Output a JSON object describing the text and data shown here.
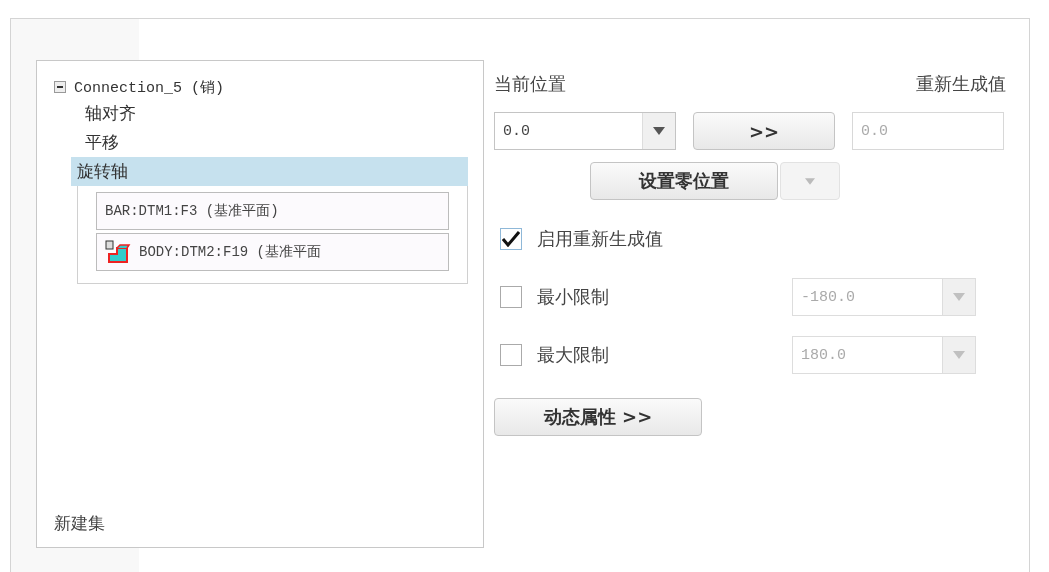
{
  "tree": {
    "root": {
      "label": "Connection_5 (销)",
      "expanded": true,
      "children": [
        {
          "label": "轴对齐",
          "selected": false
        },
        {
          "label": "平移",
          "selected": false
        },
        {
          "label": "旋转轴",
          "selected": true
        }
      ]
    },
    "references": [
      {
        "label": "BAR:DTM1:F3 (基准平面)",
        "kind": "plain"
      },
      {
        "label": "BODY:DTM2:F19 (基准平面",
        "kind": "part"
      }
    ],
    "new_set": "新建集"
  },
  "position": {
    "label": "当前位置",
    "regen_label": "重新生成值",
    "value": "0.0",
    "go_button": ">>",
    "regen_value": "0.0"
  },
  "set_zero": {
    "label": "设置零位置",
    "menu_disabled": true
  },
  "enable_regen": {
    "label": "启用重新生成值",
    "checked": true
  },
  "limits": [
    {
      "label": "最小限制",
      "checked": false,
      "value": "-180.0",
      "disabled": true
    },
    {
      "label": "最大限制",
      "checked": false,
      "value": "180.0",
      "disabled": true
    }
  ],
  "dynamic_button": "动态属性 >>"
}
